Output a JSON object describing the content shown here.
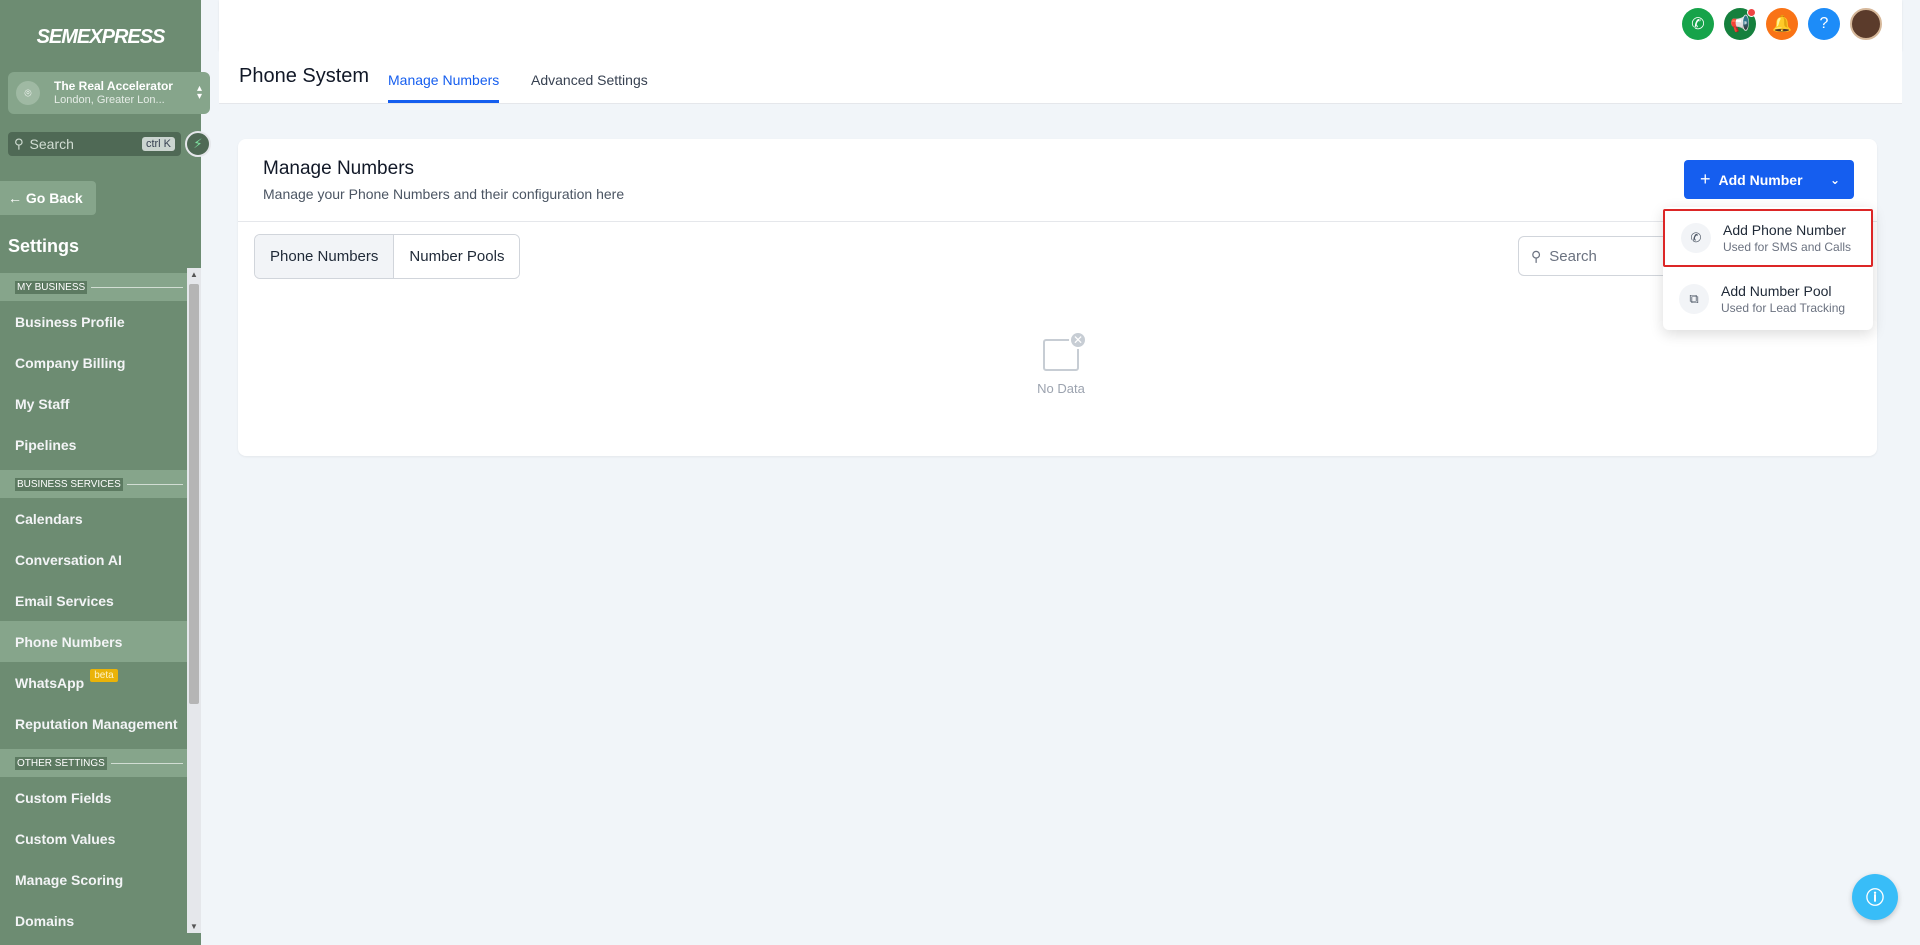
{
  "brand": {
    "logo_text": "SEMEXPRESS"
  },
  "account": {
    "name": "The Real Accelerator",
    "location": "London, Greater Lon..."
  },
  "sidebar_search": {
    "placeholder": "Search",
    "shortcut": "ctrl K"
  },
  "go_back": "Go Back",
  "settings_title": "Settings",
  "nav": {
    "section_my_business": "MY BUSINESS",
    "business_profile": "Business Profile",
    "company_billing": "Company Billing",
    "my_staff": "My Staff",
    "pipelines": "Pipelines",
    "section_business_services": "BUSINESS SERVICES",
    "calendars": "Calendars",
    "conversation_ai": "Conversation AI",
    "email_services": "Email Services",
    "phone_numbers": "Phone Numbers",
    "whatsapp": "WhatsApp",
    "whatsapp_badge": "beta",
    "reputation_management": "Reputation Management",
    "section_other_settings": "OTHER SETTINGS",
    "custom_fields": "Custom Fields",
    "custom_values": "Custom Values",
    "manage_scoring": "Manage Scoring",
    "partial_item": "Domains"
  },
  "topbar": {
    "colors": {
      "phone": "#16a34a",
      "announce": "#15803d",
      "bell": "#f97316",
      "help": "#1d8cf8"
    },
    "help_label": "?"
  },
  "page": {
    "title": "Phone System",
    "tabs": [
      "Manage Numbers",
      "Advanced Settings"
    ]
  },
  "card": {
    "title": "Manage Numbers",
    "subtitle": "Manage your Phone Numbers and their configuration here",
    "add_button": "Add Number",
    "segments": [
      "Phone Numbers",
      "Number Pools"
    ],
    "search_placeholder": "Search",
    "empty_text": "No Data"
  },
  "dropdown": {
    "items": [
      {
        "title": "Add Phone Number",
        "subtitle": "Used for SMS and Calls"
      },
      {
        "title": "Add Number Pool",
        "subtitle": "Used for Lead Tracking"
      }
    ]
  },
  "accent_color": "#155eef"
}
